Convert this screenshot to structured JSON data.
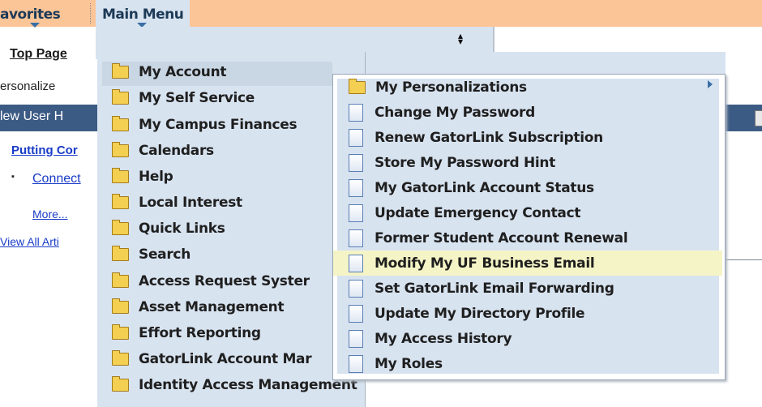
{
  "topbar": {
    "favorites_label": "avorites",
    "main_menu_label": "Main Menu"
  },
  "left": {
    "top_page": "Top Page",
    "personalize": "ersonalize",
    "header": "lew User H",
    "putting": "Putting Cor",
    "bullet": "▪",
    "connect": "Connect",
    "more": "More...",
    "view_all": "View All Arti"
  },
  "menu": {
    "items": [
      {
        "label": "My Account",
        "icon": "folder-icon"
      },
      {
        "label": "My Self Service",
        "icon": "folder-icon"
      },
      {
        "label": "My Campus Finances",
        "icon": "folder-icon"
      },
      {
        "label": "Calendars",
        "icon": "folder-icon"
      },
      {
        "label": "Help",
        "icon": "folder-icon"
      },
      {
        "label": "Local Interest",
        "icon": "folder-icon"
      },
      {
        "label": "Quick Links",
        "icon": "folder-icon"
      },
      {
        "label": "Search",
        "icon": "folder-icon"
      },
      {
        "label": "Access Request Syster",
        "icon": "folder-icon"
      },
      {
        "label": "Asset Management",
        "icon": "folder-icon"
      },
      {
        "label": "Effort Reporting",
        "icon": "folder-icon"
      },
      {
        "label": "GatorLink Account Mar",
        "icon": "folder-icon"
      },
      {
        "label": "Identity Access Management",
        "icon": "folder-icon"
      }
    ]
  },
  "submenu": {
    "items": [
      {
        "label": "My Personalizations",
        "icon": "folder-icon"
      },
      {
        "label": "Change My Password",
        "icon": "document-icon"
      },
      {
        "label": "Renew GatorLink Subscription",
        "icon": "document-icon"
      },
      {
        "label": "Store My Password Hint",
        "icon": "document-icon"
      },
      {
        "label": "My GatorLink Account Status",
        "icon": "document-icon"
      },
      {
        "label": "Update Emergency Contact",
        "icon": "document-icon"
      },
      {
        "label": "Former Student Account Renewal",
        "icon": "document-icon"
      },
      {
        "label": "Modify My UF Business Email",
        "icon": "document-icon"
      },
      {
        "label": "Set GatorLink Email Forwarding",
        "icon": "document-icon"
      },
      {
        "label": "Update My Directory Profile",
        "icon": "document-icon"
      },
      {
        "label": "My Access History",
        "icon": "document-icon"
      },
      {
        "label": "My Roles",
        "icon": "document-icon"
      }
    ]
  },
  "colors": {
    "topbar": "#fbc598",
    "menu_bg": "#d8e3f0",
    "highlight": "#f5f4c6",
    "header_bar": "#3c5b84"
  }
}
